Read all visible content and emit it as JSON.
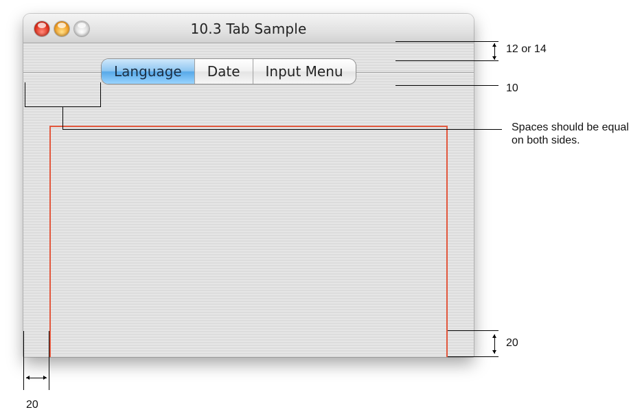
{
  "window": {
    "title": "10.3 Tab Sample"
  },
  "tabs": [
    {
      "label": "Language",
      "selected": true
    },
    {
      "label": "Date",
      "selected": false
    },
    {
      "label": "Input Menu",
      "selected": false
    }
  ],
  "annotations": {
    "top_spacing": "12 or 14",
    "tab_gap": "10",
    "equal_spaces_note": "Spaces should be equal on both sides.",
    "bottom_spacing": "20",
    "left_spacing": "20"
  },
  "colors": {
    "group_box_border": "#e2563c",
    "selected_tab": "#57a9e8"
  },
  "icons": {
    "close": "close-button-icon",
    "minimize": "minimize-button-icon",
    "zoom": "zoom-button-icon"
  }
}
